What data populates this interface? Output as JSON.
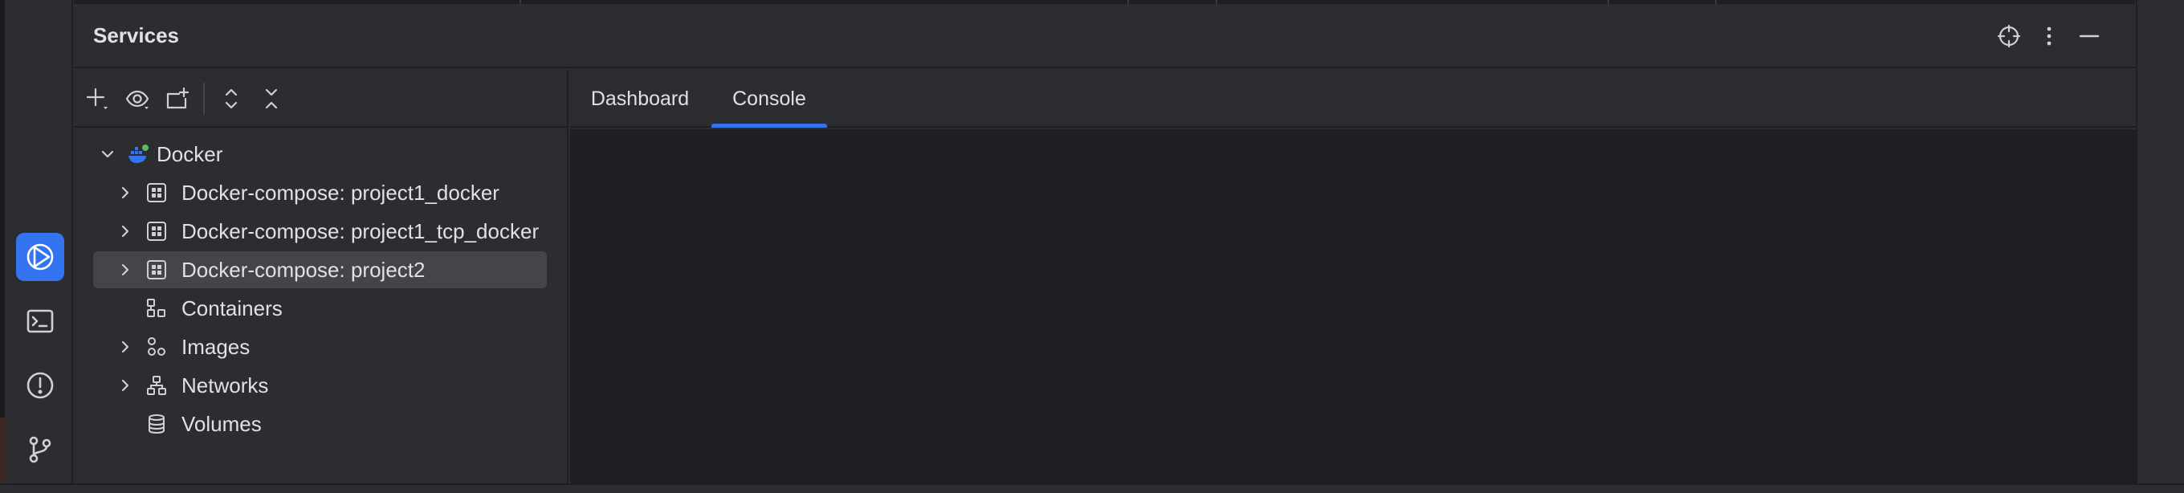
{
  "panel": {
    "title": "Services"
  },
  "header_icons": [
    "crosshair-icon",
    "more-vertical-icon",
    "minimize-icon"
  ],
  "toolbar": {
    "buttons": [
      "add-icon",
      "eye-icon",
      "new-group-icon",
      "expand-all-icon",
      "collapse-all-icon"
    ]
  },
  "tree": {
    "root": {
      "label": "Docker",
      "icon": "docker-icon",
      "expanded": true
    },
    "items": [
      {
        "label": "Docker-compose: project1_docker",
        "icon": "compose-icon",
        "expandable": true,
        "selected": false
      },
      {
        "label": "Docker-compose: project1_tcp_docker",
        "icon": "compose-icon",
        "expandable": true,
        "selected": false
      },
      {
        "label": "Docker-compose: project2",
        "icon": "compose-icon",
        "expandable": true,
        "selected": true
      },
      {
        "label": "Containers",
        "icon": "containers-icon",
        "expandable": false,
        "selected": false
      },
      {
        "label": "Images",
        "icon": "images-icon",
        "expandable": true,
        "selected": false
      },
      {
        "label": "Networks",
        "icon": "networks-icon",
        "expandable": true,
        "selected": false
      },
      {
        "label": "Volumes",
        "icon": "volumes-icon",
        "expandable": false,
        "selected": false
      }
    ]
  },
  "tabs": [
    {
      "label": "Dashboard",
      "active": false
    },
    {
      "label": "Console",
      "active": true
    }
  ],
  "left_stripe": [
    "services-icon",
    "terminal-icon",
    "problems-icon",
    "git-branch-icon"
  ],
  "colors": {
    "accent": "#3574f0",
    "panel_bg": "#2b2d30",
    "console_bg": "#1e1f22",
    "selection_bg": "#43454a",
    "text": "#dfe1e5"
  }
}
